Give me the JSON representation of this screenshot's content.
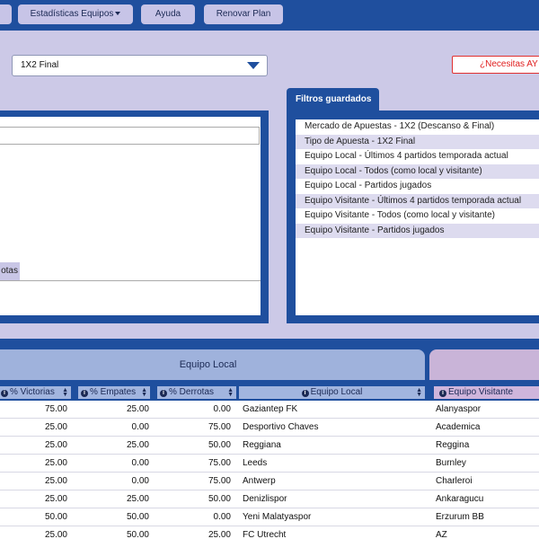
{
  "nav": {
    "first": "",
    "team_stats": "Estadísticas Equipos",
    "help": "Ayuda",
    "renew": "Renovar Plan"
  },
  "market_select": {
    "value": "1X2 Final"
  },
  "help_button": "¿Necesitas AY",
  "left_panel": {
    "tab_label": "otas"
  },
  "saved_filters": {
    "title": "Filtros guardados",
    "items": [
      "Mercado de Apuestas - 1X2 (Descanso & Final)",
      "Tipo de Apuesta - 1X2 Final",
      "Equipo Local - Últimos 4 partidos temporada actual",
      "Equipo Local - Todos (como local y visitante)",
      "Equipo Local - Partidos jugados",
      "Equipo Visitante - Últimos 4 partidos temporada actual",
      "Equipo Visitante - Todos (como local y visitante)",
      "Equipo Visitante - Partidos jugados"
    ]
  },
  "results": {
    "group_local": "Equipo Local",
    "columns": {
      "victorias": "% Victorias",
      "empates": "% Empates",
      "derrotas": "% Derrotas",
      "local": "Equipo Local",
      "visitante": "Equipo Visitante"
    },
    "rows": [
      {
        "v": "75.00",
        "e": "25.00",
        "d": "0.00",
        "home": "Gaziantep FK",
        "away": "Alanyaspor"
      },
      {
        "v": "25.00",
        "e": "0.00",
        "d": "75.00",
        "home": "Desportivo Chaves",
        "away": "Academica"
      },
      {
        "v": "25.00",
        "e": "25.00",
        "d": "50.00",
        "home": "Reggiana",
        "away": "Reggina"
      },
      {
        "v": "25.00",
        "e": "0.00",
        "d": "75.00",
        "home": "Leeds",
        "away": "Burnley"
      },
      {
        "v": "25.00",
        "e": "0.00",
        "d": "75.00",
        "home": "Antwerp",
        "away": "Charleroi"
      },
      {
        "v": "25.00",
        "e": "25.00",
        "d": "50.00",
        "home": "Denizlispor",
        "away": "Ankaragucu"
      },
      {
        "v": "50.00",
        "e": "50.00",
        "d": "0.00",
        "home": "Yeni Malatyaspor",
        "away": "Erzurum BB"
      },
      {
        "v": "25.00",
        "e": "50.00",
        "d": "25.00",
        "home": "FC Utrecht",
        "away": "AZ"
      }
    ]
  }
}
